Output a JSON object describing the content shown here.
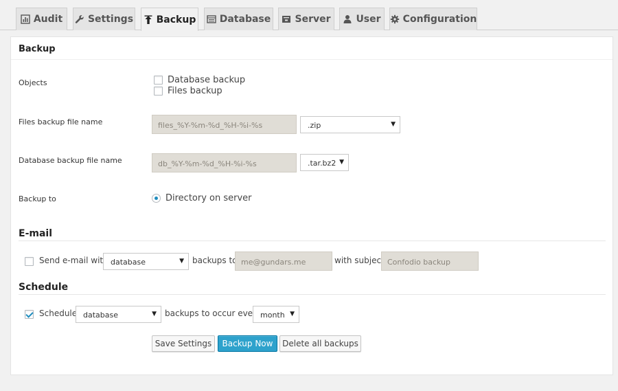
{
  "tabs": [
    {
      "label": "Audit",
      "icon": "bar-chart-icon",
      "active": false
    },
    {
      "label": "Settings",
      "icon": "wrench-icon",
      "active": false
    },
    {
      "label": "Backup",
      "icon": "upload-arrow-icon",
      "active": true
    },
    {
      "label": "Database",
      "icon": "table-icon",
      "active": false
    },
    {
      "label": "Server",
      "icon": "server-icon",
      "active": false
    },
    {
      "label": "User",
      "icon": "user-icon",
      "active": false
    },
    {
      "label": "Configuration",
      "icon": "gear-icon",
      "active": false
    }
  ],
  "panel": {
    "title": "Backup"
  },
  "backup": {
    "objects_label": "Objects",
    "objects": [
      {
        "label": "Database backup",
        "checked": false
      },
      {
        "label": "Files backup",
        "checked": false
      }
    ],
    "files_name_label": "Files backup file name",
    "files_name_value": "files_%Y-%m-%d_%H-%i-%s",
    "files_ext": ".zip",
    "db_name_label": "Database backup file name",
    "db_name_value": "db_%Y-%m-%d_%H-%i-%s",
    "db_ext": ".tar.bz2",
    "backup_to_label": "Backup to",
    "backup_to_option": "Directory on server",
    "backup_to_selected": true
  },
  "email": {
    "title": "E-mail",
    "checked": false,
    "send_label": "Send e-mail with",
    "type": "database",
    "backups_to": "backups to",
    "address": "me@gundars.me",
    "with_subject": "with subject",
    "subject": "Confodio backup"
  },
  "schedule": {
    "title": "Schedule",
    "checked": true,
    "label": "Schedule",
    "type": "database",
    "occur_label": "backups to occur every",
    "period": "month"
  },
  "buttons": {
    "save": "Save Settings",
    "backup_now": "Backup Now",
    "delete_all": "Delete all backups"
  },
  "colors": {
    "primary": "#2ea2cc",
    "check_accent": "#1e8cbe"
  }
}
